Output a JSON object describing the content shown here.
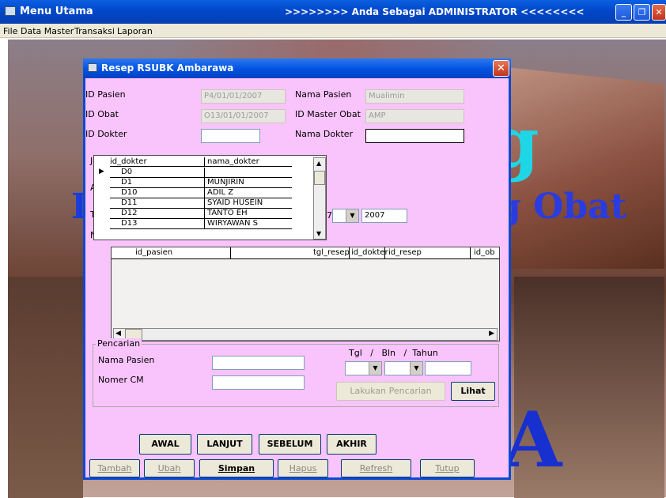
{
  "main_window": {
    "title": "Menu Utama",
    "banner": ">>>>>>>> Anda Sebagai ADMINISTRATOR <<<<<<<<"
  },
  "menu": [
    "File",
    "Data Master",
    "Transaksi",
    "Laporan"
  ],
  "background_text": {
    "g": "g",
    "obat": "g Obat",
    "a": "A"
  },
  "dialog": {
    "title": "Resep RSUBK Ambarawa",
    "fields": {
      "id_pasien": {
        "label": "ID Pasien",
        "value": "P4/01/01/2007"
      },
      "nama_pasien": {
        "label": "Nama Pasien",
        "value": "Mualimin"
      },
      "id_obat": {
        "label": "ID Obat",
        "value": "O13/01/01/2007"
      },
      "id_master_obat": {
        "label": "ID Master Obat",
        "value": "AMP"
      },
      "id_dokter": {
        "label": "ID Dokter",
        "value": ""
      },
      "nama_dokter": {
        "label": "Nama Dokter",
        "value": ""
      }
    },
    "hidden_labels": [
      "J",
      "A",
      "T",
      "N"
    ],
    "date_row": {
      "day_partial": "7",
      "year": "2007"
    },
    "doctor_dropdown": {
      "columns": [
        "id_dokter",
        "nama_dokter"
      ],
      "rows": [
        [
          "D0",
          ""
        ],
        [
          "D1",
          "MUNJIRIN"
        ],
        [
          "D10",
          "ADIL Z"
        ],
        [
          "D11",
          "SYAID HUSEIN"
        ],
        [
          "D12",
          "TANTO EH"
        ],
        [
          "D13",
          "WIRYAWAN S"
        ]
      ]
    },
    "grid": {
      "columns": [
        "id_pasien",
        "tgl_resep",
        "id_dokter",
        "id_resep",
        "id_ob"
      ]
    },
    "search": {
      "group_label": "Pencarian",
      "nama_pasien_label": "Nama Pasien",
      "nomer_cm_label": "Nomer CM",
      "date_label": "Tgl   /   Bln   /  Tahun",
      "search_button": "Lakukan Pencarian",
      "view_button": "Lihat"
    },
    "nav_buttons": [
      "AWAL",
      "LANJUT",
      "SEBELUM",
      "AKHIR"
    ],
    "action_buttons": [
      "Tambah",
      "Ubah",
      "Simpan",
      "Hapus",
      "Refresh",
      "Tutup"
    ]
  }
}
